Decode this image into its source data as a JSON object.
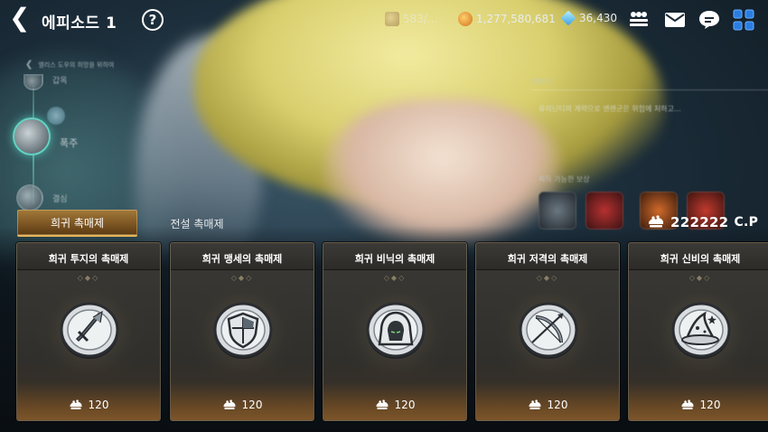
{
  "header": {
    "title": "에피소드 1",
    "help_icon": "?",
    "resources": [
      {
        "name": "stamina",
        "value": "583/..."
      },
      {
        "name": "gold",
        "value": "1,277,580,681"
      },
      {
        "name": "crystal",
        "value": "36,430"
      }
    ],
    "icons": [
      "users-icon",
      "mail-icon",
      "chat-icon",
      "menu-grid-icon"
    ]
  },
  "episode": {
    "subtitle": "엘리스 도우의 희망을 위하여",
    "stages": [
      {
        "label": "갑옥"
      },
      {
        "label": "폭주"
      },
      {
        "label": "결심"
      }
    ]
  },
  "story": {
    "header": "이야기",
    "text": "유리닌티의 계략으로 엔젠군은 위험에 처하고...",
    "reward_header": "획득 가능한 보상"
  },
  "tabs": [
    {
      "label": "희귀 촉매제",
      "active": true
    },
    {
      "label": "전설 촉매제",
      "active": false
    }
  ],
  "currency": {
    "amount": "222222",
    "unit": "C.P"
  },
  "cards": [
    {
      "title": "희귀 투지의 촉매제",
      "icon": "sword-emblem-icon",
      "price": "120"
    },
    {
      "title": "희귀 맹세의 촉매제",
      "icon": "shield-emblem-icon",
      "price": "120"
    },
    {
      "title": "희귀 비닉의 촉매제",
      "icon": "hood-emblem-icon",
      "price": "120"
    },
    {
      "title": "희귀 저격의 촉매제",
      "icon": "bow-emblem-icon",
      "price": "120"
    },
    {
      "title": "희귀 신비의 촉매제",
      "icon": "wizard-hat-emblem-icon",
      "price": "120"
    }
  ],
  "colors": {
    "active_tab": "#7d5623",
    "accent_gold": "#e5b55a",
    "stage_glow": "#63d2c3"
  }
}
